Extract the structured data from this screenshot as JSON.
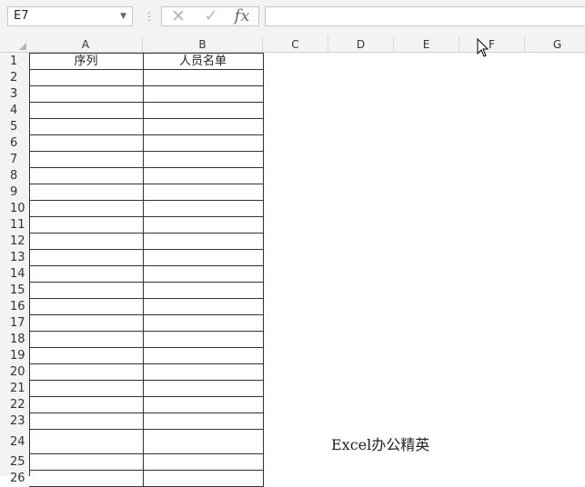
{
  "name_box": {
    "value": "E7",
    "dropdown_icon": "chevron-down-icon"
  },
  "formula_bar": {
    "more_icon": "⋮",
    "cancel_icon": "✕",
    "enter_icon": "✓",
    "fx_label": "fx",
    "formula_value": ""
  },
  "columns": [
    "A",
    "B",
    "C",
    "D",
    "E",
    "F",
    "G"
  ],
  "rows": [
    "1",
    "2",
    "3",
    "4",
    "5",
    "6",
    "7",
    "8",
    "9",
    "10",
    "11",
    "12",
    "13",
    "14",
    "15",
    "16",
    "17",
    "18",
    "19",
    "20",
    "21",
    "22",
    "23",
    "24",
    "25",
    "26"
  ],
  "cells": {
    "A1": "序列",
    "B1": "人员名单"
  },
  "watermark": "Excel办公精英",
  "colors": {
    "grid_border": "#333333",
    "header_bg": "#f3f3f3"
  }
}
